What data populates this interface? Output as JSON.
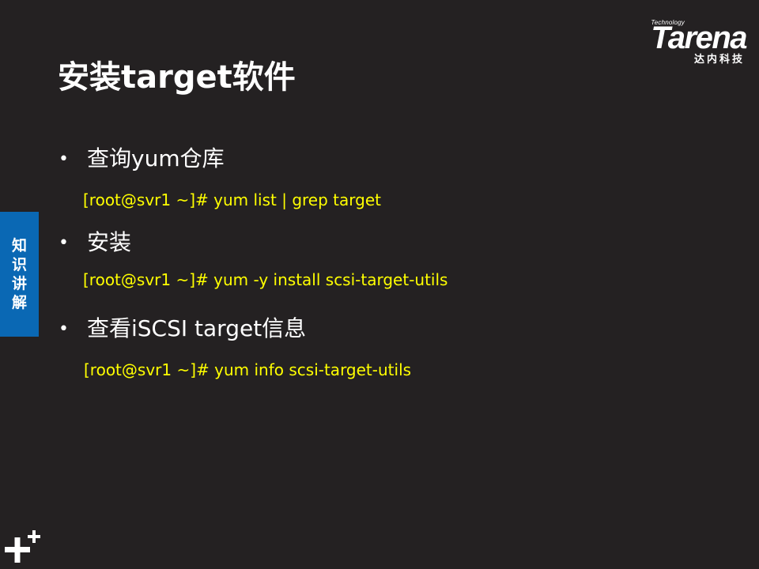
{
  "logo": {
    "small_text": "Technology",
    "word": "Tarena",
    "chinese": "达内科技"
  },
  "title": "安装target软件",
  "side_tab": {
    "label": "知识讲解"
  },
  "items": [
    {
      "bullet": "查询yum仓库",
      "command": "[root@svr1 ~]# yum list | grep target"
    },
    {
      "bullet": "安装",
      "command": "[root@svr1 ~]# yum -y install scsi-target-utils"
    },
    {
      "bullet": "查看iSCSI target信息",
      "command": "[root@svr1 ~]# yum info scsi-target-utils"
    }
  ],
  "colors": {
    "background": "#242122",
    "command_text": "#ffff00",
    "side_tab": "#0a68b4",
    "text": "#ffffff"
  },
  "icons": {
    "bottom_left": "plus-icon"
  }
}
